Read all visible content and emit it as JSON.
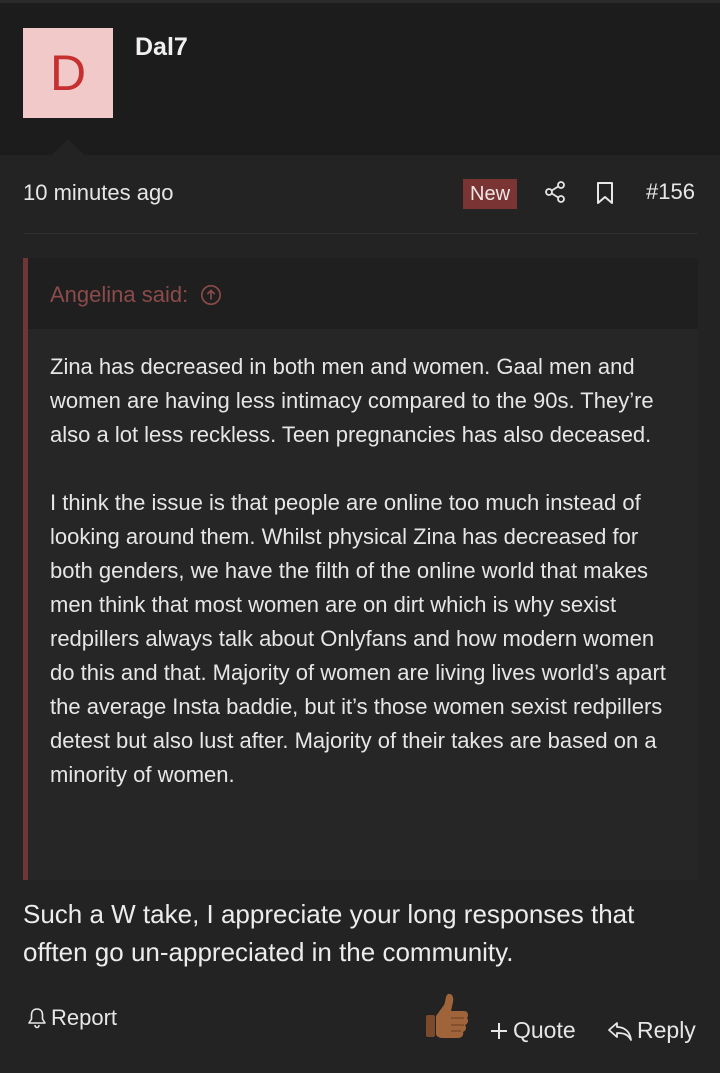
{
  "user": {
    "avatar_letter": "D",
    "avatar_bg": "#f2c9c9",
    "avatar_fg": "#c73030",
    "name": "Dal7"
  },
  "meta": {
    "timestamp": "10 minutes ago",
    "badge": "New",
    "post_number": "#156",
    "icons": [
      "share-icon",
      "bookmark-icon"
    ]
  },
  "quote": {
    "author": "Angelina said:",
    "paragraphs": [
      "Zina has decreased in both men and women. Gaal men and women are having less intimacy compared to the 90s. They’re also a lot less reckless. Teen pregnancies has also deceased.",
      "I think the issue is that people are online too much instead of looking around them. Whilst physical Zina has decreased for both genders, we have the filth of the online world that makes men think that most women are on dirt which is why sexist redpillers always talk about Onlyfans and how modern women do this and that. Majority of women are living lives world’s apart the average Insta baddie, but it’s those women sexist redpillers detest but also lust after. Majority of their takes are based on a minority of women."
    ]
  },
  "reply": {
    "text": "Such a W take, I appreciate your long responses that offten go un-appreciated in the community."
  },
  "actions": {
    "report": "Report",
    "quote": "Quote",
    "reply": "Reply",
    "reaction_icon": "thumbs-up-icon"
  },
  "colors": {
    "background": "#1c1c1c",
    "panel": "#232323",
    "accent": "#7a3434",
    "quote_author": "#8c4b4b"
  }
}
